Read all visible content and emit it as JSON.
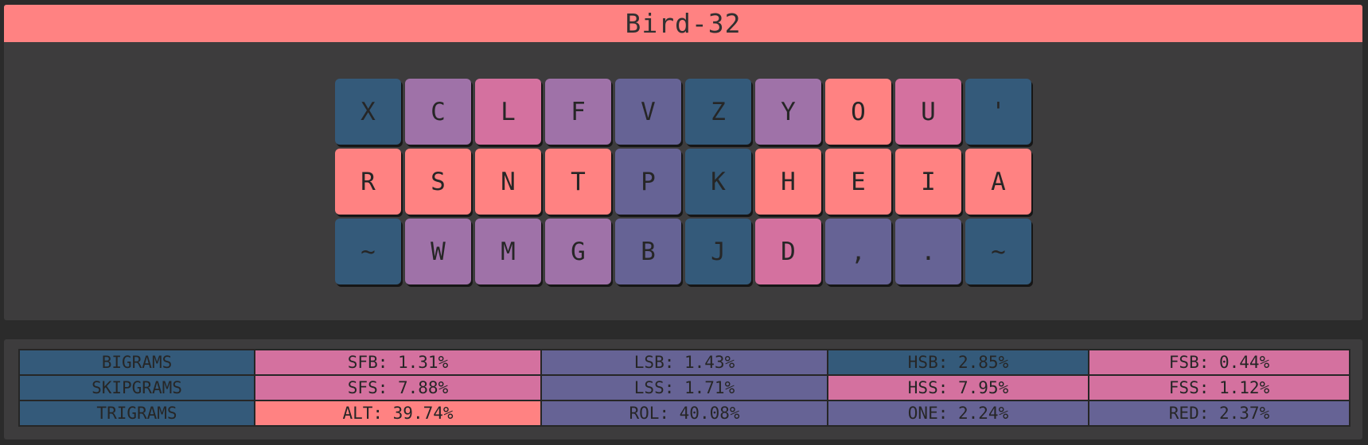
{
  "title": "Bird-32",
  "colors": {
    "blue": "#345a7a",
    "violet": "#9f72a8",
    "pink": "#d4719f",
    "salmon": "#ff8282",
    "indigo": "#666395",
    "panel": "#3d3c3d",
    "background": "#2b2b2b"
  },
  "keyboard": {
    "rows": [
      [
        "X",
        "C",
        "L",
        "F",
        "V",
        "Z",
        "Y",
        "O",
        "U",
        "'"
      ],
      [
        "R",
        "S",
        "N",
        "T",
        "P",
        "K",
        "H",
        "E",
        "I",
        "A"
      ],
      [
        "~",
        "W",
        "M",
        "G",
        "B",
        "J",
        "D",
        ",",
        ".",
        "~"
      ]
    ],
    "row_colors": [
      [
        "blue",
        "violet",
        "pink",
        "violet",
        "indigo",
        "blue",
        "violet",
        "salmon",
        "pink",
        "blue"
      ],
      [
        "salmon",
        "salmon",
        "salmon",
        "salmon",
        "indigo",
        "blue",
        "salmon",
        "salmon",
        "salmon",
        "salmon"
      ],
      [
        "blue",
        "violet",
        "violet",
        "violet",
        "indigo",
        "blue",
        "pink",
        "indigo",
        "indigo",
        "blue"
      ]
    ]
  },
  "stats": {
    "rows": [
      {
        "label": "BIGRAMS",
        "cells": [
          "SFB: 1.31%",
          "LSB: 1.43%",
          "HSB: 2.85%",
          "FSB: 0.44%"
        ]
      },
      {
        "label": "SKIPGRAMS",
        "cells": [
          "SFS: 7.88%",
          "LSS: 1.71%",
          "HSS: 7.95%",
          "FSS: 1.12%"
        ]
      },
      {
        "label": "TRIGRAMS",
        "cells": [
          "ALT: 39.74%",
          "ROL: 40.08%",
          "ONE: 2.24%",
          "RED: 2.37%"
        ]
      }
    ],
    "cell_colors": [
      [
        "pink",
        "indigo",
        "blue",
        "pink"
      ],
      [
        "pink",
        "indigo",
        "pink",
        "pink"
      ],
      [
        "salmon",
        "indigo",
        "indigo",
        "indigo"
      ]
    ]
  }
}
